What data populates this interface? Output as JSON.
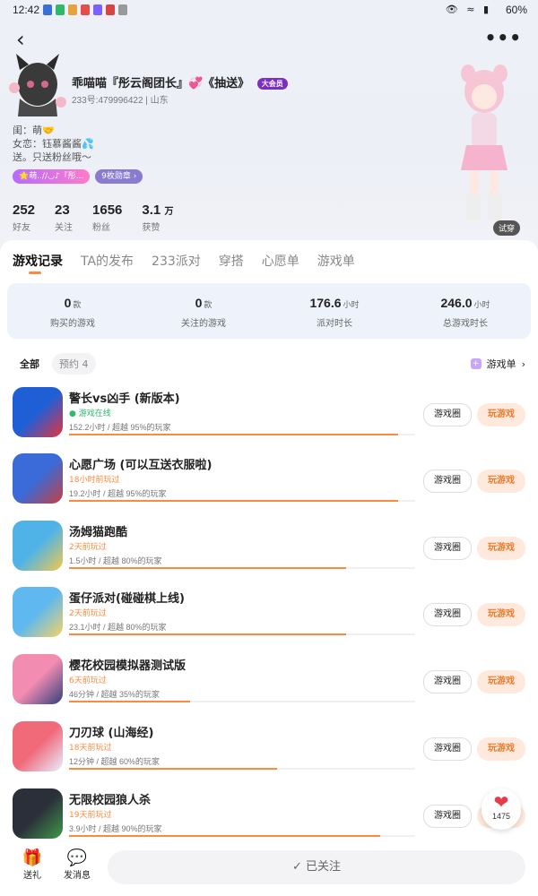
{
  "status_bar": {
    "time": "12:42",
    "battery": "60%"
  },
  "profile": {
    "name": "乖喵喵『彤云阁团长』💞《抽送》",
    "vip": "大会员",
    "uid": "233号:479996422 | 山东",
    "bio": [
      "闺：萌🤝",
      "女恋：钰慕酱酱💦",
      "送。只送粉丝哦～"
    ],
    "tags": [
      "🌟萌..//◡♪『彤...",
      "9枚勋章 ›"
    ],
    "stats": [
      {
        "num": "252",
        "label": "好友"
      },
      {
        "num": "23",
        "label": "关注"
      },
      {
        "num": "1656",
        "label": "粉丝"
      },
      {
        "num": "3.1",
        "unit": "万",
        "label": "获赞"
      }
    ],
    "try_on": "试穿"
  },
  "tabs": [
    "游戏记录",
    "TA的发布",
    "233派对",
    "穿搭",
    "心愿单",
    "游戏单"
  ],
  "summary": [
    {
      "value": "0",
      "unit": "款",
      "label": "购买的游戏"
    },
    {
      "value": "0",
      "unit": "款",
      "label": "关注的游戏"
    },
    {
      "value": "176.6",
      "unit": "小时",
      "label": "派对时长"
    },
    {
      "value": "246.0",
      "unit": "小时",
      "label": "总游戏时长"
    }
  ],
  "filters": {
    "all": "全部",
    "reserve": "预约 4",
    "gamelist": "游戏单"
  },
  "games": [
    {
      "name": "警长vs凶手 (新版本)",
      "status": "● 游戏在线",
      "online": true,
      "play": "152.2小时 / 超越 95%的玩家",
      "progress": 0.95,
      "colors": [
        "#1f5fd6",
        "#e8323c"
      ]
    },
    {
      "name": "心愿广场 (可以互送衣服啦)",
      "status": "18小时前玩过",
      "online": false,
      "play": "19.2小时 / 超越 95%的玩家",
      "progress": 0.95,
      "colors": [
        "#3a6bd8",
        "#c73f3f"
      ]
    },
    {
      "name": "汤姆猫跑酷",
      "status": "2天前玩过",
      "online": false,
      "play": "1.5小时 / 超越 80%的玩家",
      "progress": 0.8,
      "colors": [
        "#4fb3e8",
        "#f2c94c"
      ]
    },
    {
      "name": "蛋仔派对(碰碰棋上线)",
      "status": "2天前玩过",
      "online": false,
      "play": "23.1小时 / 超越 80%的玩家",
      "progress": 0.8,
      "colors": [
        "#5fb8f0",
        "#f6d365"
      ]
    },
    {
      "name": "樱花校园模拟器测试版",
      "status": "6天前玩过",
      "online": false,
      "play": "46分钟 / 超越 35%的玩家",
      "progress": 0.35,
      "colors": [
        "#f28cb1",
        "#2f3f7a"
      ]
    },
    {
      "name": "刀刃球 (山海经)",
      "status": "18天前玩过",
      "online": false,
      "play": "12分钟 / 超越 60%的玩家",
      "progress": 0.6,
      "colors": [
        "#f06a7a",
        "#e9f0ff"
      ]
    },
    {
      "name": "无限校园狼人杀",
      "status": "19天前玩过",
      "online": false,
      "play": "3.9小时 / 超越 90%的玩家",
      "progress": 0.9,
      "colors": [
        "#2b2f3a",
        "#3f9a4a"
      ]
    }
  ],
  "buttons": {
    "circle": "游戏圈",
    "play": "玩游戏"
  },
  "bottom": {
    "gift": "送礼",
    "message": "发消息",
    "follow": "✓ 已关注",
    "likes": "1475"
  }
}
